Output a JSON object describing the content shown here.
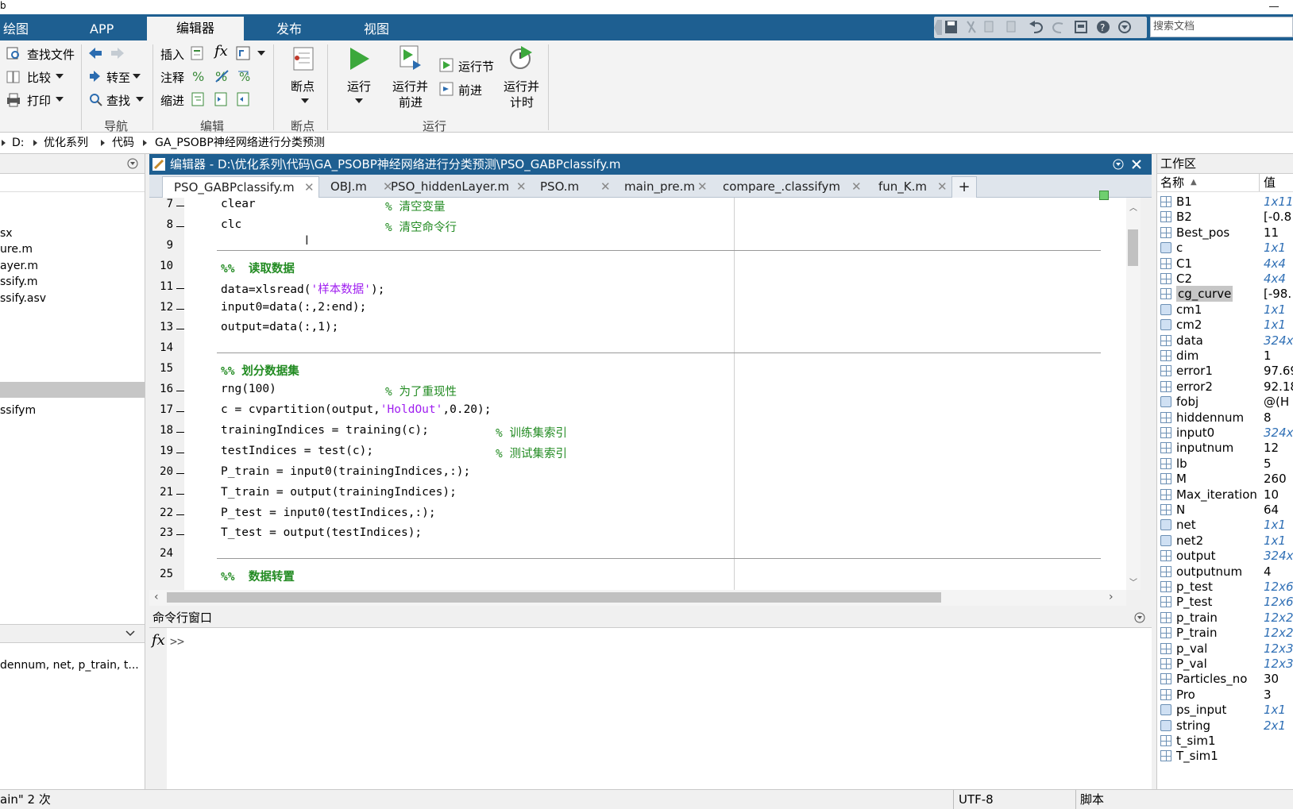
{
  "window": {
    "title_char": "b"
  },
  "main_tabs": [
    {
      "label": "绘图"
    },
    {
      "label": "APP"
    },
    {
      "label": "编辑器"
    },
    {
      "label": "发布"
    },
    {
      "label": "视图"
    }
  ],
  "search": {
    "placeholder": "搜索文档"
  },
  "ribbon": {
    "file": {
      "find_files": "查找文件",
      "compare": "比较",
      "print": "打印"
    },
    "navigate": {
      "goto": "转至",
      "find": "查找",
      "group_label": "导航"
    },
    "edit": {
      "insert": "插入",
      "comment": "注释",
      "indent": "缩进",
      "group_label": "编辑",
      "fx": "fx"
    },
    "breakpoints": {
      "label": "断点",
      "group_label": "断点"
    },
    "run": {
      "run": "运行",
      "run_advance_1": "运行并",
      "run_advance_2": "前进",
      "run_section": "运行节",
      "advance": "前进",
      "run_time_1": "运行并",
      "run_time_2": "计时",
      "group_label": "运行"
    }
  },
  "breadcrumb": [
    "D:",
    "优化系列",
    "代码",
    "GA_PSOBP神经网络进行分类预测"
  ],
  "left_pane": {
    "files": [
      "sx",
      "ure.m",
      "ayer.m",
      "ssify.m",
      "ssify.asv",
      "ssifym"
    ],
    "details_text": "dennum, net, p_train, t..."
  },
  "editor": {
    "title": "编辑器 - D:\\优化系列\\代码\\GA_PSOBP神经网络进行分类预测\\PSO_GABPclassify.m",
    "tabs": [
      "PSO_GABPclassify.m",
      "OBJ.m",
      "PSO_hiddenLayer.m",
      "PSO.m",
      "main_pre.m",
      "compare_.classifym",
      "fun_K.m"
    ],
    "add_tab": "+",
    "lines": [
      {
        "n": "7",
        "dash": true,
        "code": "clear",
        "comment": "% 清空变量",
        "cpos": 1
      },
      {
        "n": "8",
        "dash": true,
        "code": "clc",
        "comment": "% 清空命令行",
        "cpos": 1
      },
      {
        "n": "9",
        "dash": false,
        "code": ""
      },
      {
        "n": "10",
        "dash": false,
        "section": "%%  读取数据"
      },
      {
        "n": "11",
        "dash": true,
        "pre": "data=xlsread(",
        "str": "'样本数据'",
        "post": ");"
      },
      {
        "n": "12",
        "dash": true,
        "code": "input0=data(:,2:end);"
      },
      {
        "n": "13",
        "dash": true,
        "code": "output=data(:,1);"
      },
      {
        "n": "14",
        "dash": false,
        "code": ""
      },
      {
        "n": "15",
        "dash": false,
        "section": "%% 划分数据集"
      },
      {
        "n": "16",
        "dash": true,
        "code": "rng(100)",
        "comment": "% 为了重现性",
        "cpos": 1
      },
      {
        "n": "17",
        "dash": true,
        "pre": "c = cvpartition(output,",
        "str": "'HoldOut'",
        "post": ",0.20);"
      },
      {
        "n": "18",
        "dash": true,
        "code": "trainingIndices = training(c);",
        "comment": "% 训练集索引",
        "cpos": 2
      },
      {
        "n": "19",
        "dash": true,
        "code": "testIndices = test(c);",
        "comment": "% 测试集索引",
        "cpos": 2
      },
      {
        "n": "20",
        "dash": true,
        "code": "P_train = input0(trainingIndices,:);"
      },
      {
        "n": "21",
        "dash": true,
        "code": "T_train = output(trainingIndices);"
      },
      {
        "n": "22",
        "dash": true,
        "code": "P_test = input0(testIndices,:);"
      },
      {
        "n": "23",
        "dash": true,
        "code": "T_test = output(testIndices);"
      },
      {
        "n": "24",
        "dash": false,
        "code": ""
      },
      {
        "n": "25",
        "dash": false,
        "section": "%%  数据转置"
      }
    ]
  },
  "command_window": {
    "title": "命令行窗口",
    "fx": "fx",
    "prompt": ">>"
  },
  "workspace": {
    "title": "工作区",
    "col_name": "名称",
    "col_value": "值",
    "vars": [
      {
        "name": "B1",
        "value": "1x11",
        "icon": "grid",
        "italic": true
      },
      {
        "name": "B2",
        "value": "[-0.8",
        "icon": "grid",
        "italic": false
      },
      {
        "name": "Best_pos",
        "value": "11",
        "icon": "grid",
        "italic": false
      },
      {
        "name": "c",
        "value": "1x1",
        "icon": "obj",
        "italic": true
      },
      {
        "name": "C1",
        "value": "4x4",
        "icon": "grid",
        "italic": true
      },
      {
        "name": "C2",
        "value": "4x4",
        "icon": "grid",
        "italic": true
      },
      {
        "name": "cg_curve",
        "value": "[-98.",
        "icon": "grid",
        "italic": false,
        "selected": true
      },
      {
        "name": "cm1",
        "value": "1x1",
        "icon": "obj",
        "italic": true
      },
      {
        "name": "cm2",
        "value": "1x1",
        "icon": "obj",
        "italic": true
      },
      {
        "name": "data",
        "value": "324x",
        "icon": "grid",
        "italic": true
      },
      {
        "name": "dim",
        "value": "1",
        "icon": "grid",
        "italic": false
      },
      {
        "name": "error1",
        "value": "97.69",
        "icon": "grid",
        "italic": false
      },
      {
        "name": "error2",
        "value": "92.18",
        "icon": "grid",
        "italic": false
      },
      {
        "name": "fobj",
        "value": "@(H",
        "icon": "obj",
        "italic": false
      },
      {
        "name": "hiddennum",
        "value": "8",
        "icon": "grid",
        "italic": false
      },
      {
        "name": "input0",
        "value": "324x",
        "icon": "grid",
        "italic": true
      },
      {
        "name": "inputnum",
        "value": "12",
        "icon": "grid",
        "italic": false
      },
      {
        "name": "lb",
        "value": "5",
        "icon": "grid",
        "italic": false
      },
      {
        "name": "M",
        "value": "260",
        "icon": "grid",
        "italic": false
      },
      {
        "name": "Max_iteration",
        "value": "10",
        "icon": "grid",
        "italic": false
      },
      {
        "name": "N",
        "value": "64",
        "icon": "grid",
        "italic": false
      },
      {
        "name": "net",
        "value": "1x1",
        "icon": "obj",
        "italic": true
      },
      {
        "name": "net2",
        "value": "1x1",
        "icon": "obj",
        "italic": true
      },
      {
        "name": "output",
        "value": "324x",
        "icon": "grid",
        "italic": true
      },
      {
        "name": "outputnum",
        "value": "4",
        "icon": "grid",
        "italic": false
      },
      {
        "name": "p_test",
        "value": "12x6",
        "icon": "grid",
        "italic": true
      },
      {
        "name": "P_test",
        "value": "12x6",
        "icon": "grid",
        "italic": true
      },
      {
        "name": "p_train",
        "value": "12x2",
        "icon": "grid",
        "italic": true
      },
      {
        "name": "P_train",
        "value": "12x2",
        "icon": "grid",
        "italic": true
      },
      {
        "name": "p_val",
        "value": "12x3",
        "icon": "grid",
        "italic": true
      },
      {
        "name": "P_val",
        "value": "12x3",
        "icon": "grid",
        "italic": true
      },
      {
        "name": "Particles_no",
        "value": "30",
        "icon": "grid",
        "italic": false
      },
      {
        "name": "Pro",
        "value": "3",
        "icon": "grid",
        "italic": false
      },
      {
        "name": "ps_input",
        "value": "1x1",
        "icon": "obj",
        "italic": true
      },
      {
        "name": "string",
        "value": "2x1",
        "icon": "obj",
        "italic": true
      },
      {
        "name": "t_sim1",
        "value": "",
        "icon": "grid",
        "italic": false
      },
      {
        "name": "T_sim1",
        "value": "",
        "icon": "grid",
        "italic": false
      }
    ]
  },
  "status": {
    "left": "ain\" 2 次",
    "encoding": "UTF-8",
    "type": "脚本"
  },
  "colors": {
    "title_blue": "#1e5f91",
    "comment_green": "#228b22",
    "string_purple": "#a020f0",
    "run_green": "#3ca83c"
  }
}
